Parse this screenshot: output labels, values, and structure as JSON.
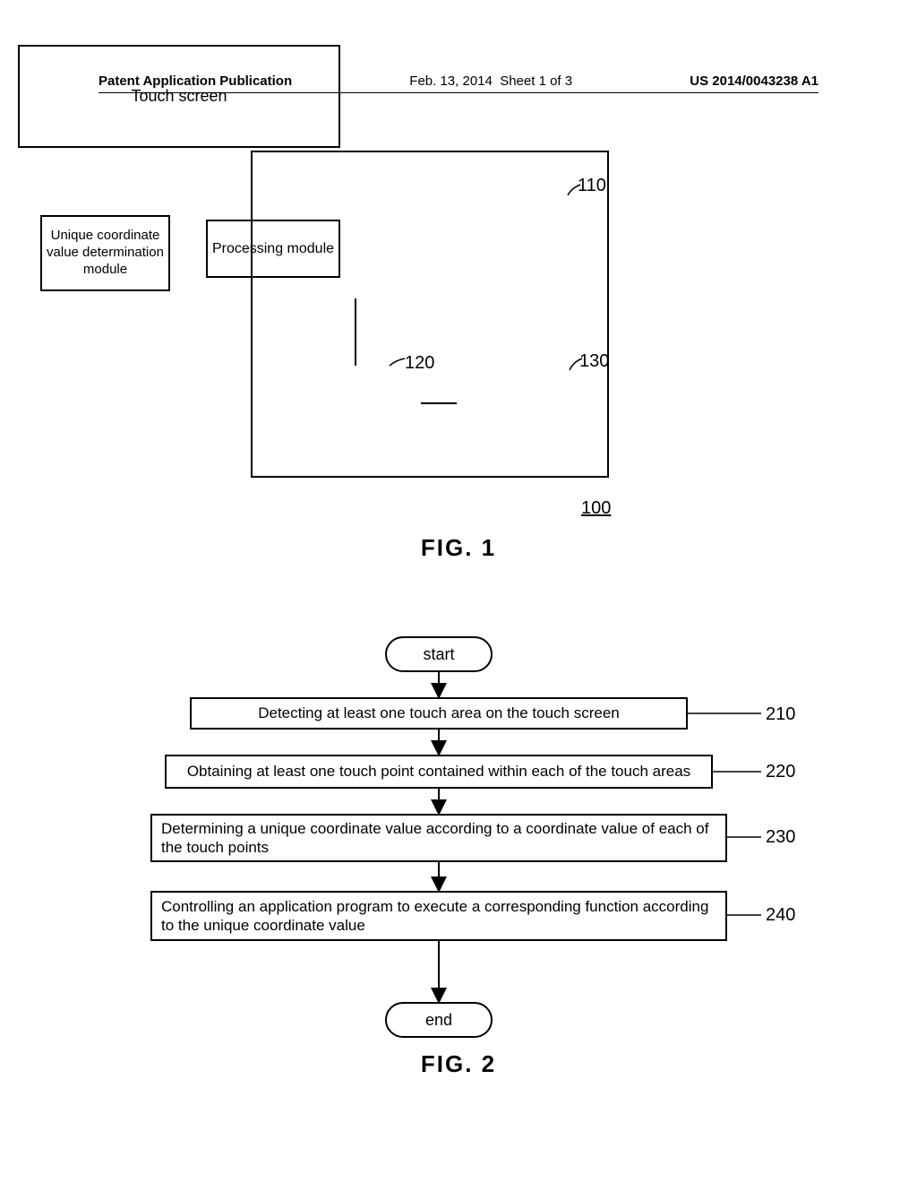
{
  "header": {
    "left": "Patent Application Publication",
    "date": "Feb. 13, 2014",
    "sheet": "Sheet 1 of 3",
    "pubno": "US 2014/0043238 A1"
  },
  "fig1": {
    "caption": "FIG. 1",
    "outer_ref": "100",
    "blocks": {
      "touch_screen": {
        "label": "Touch screen",
        "ref": "110"
      },
      "coord_module": {
        "label": "Unique coordinate value determination module",
        "ref": "120"
      },
      "proc_module": {
        "label": "Processing module",
        "ref": "130"
      }
    }
  },
  "fig2": {
    "caption": "FIG. 2",
    "start": "start",
    "end": "end",
    "steps": [
      {
        "ref": "210",
        "text": "Detecting at least one touch area on the touch screen"
      },
      {
        "ref": "220",
        "text": "Obtaining at least one touch point contained within each of the touch areas"
      },
      {
        "ref": "230",
        "text": "Determining a unique coordinate value according to a coordinate value of each of the touch points"
      },
      {
        "ref": "240",
        "text": "Controlling an application program to execute a corresponding function according to the unique coordinate value"
      }
    ]
  }
}
